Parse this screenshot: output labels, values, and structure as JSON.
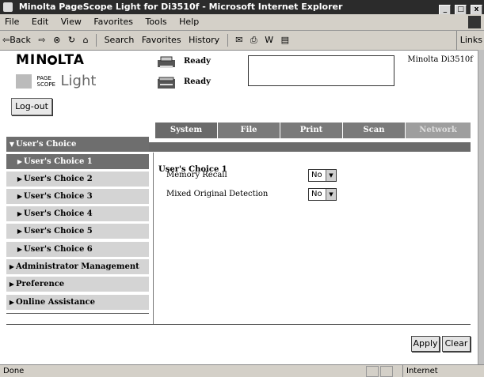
{
  "window": {
    "title": "Minolta PageScope Light for Di3510f - Microsoft Internet Explorer",
    "controls": [
      "_",
      "□",
      "x"
    ]
  },
  "menu": {
    "items": [
      "File",
      "Edit",
      "View",
      "Favorites",
      "Tools",
      "Help"
    ]
  },
  "toolbar": {
    "back": "⇦Back",
    "forward": "⇨",
    "stop": "⊗",
    "refresh": "↻",
    "home": "⌂",
    "search": "Search",
    "favorites": "Favorites",
    "history": "History",
    "mail": "✉",
    "print": "⎙",
    "edit": "W",
    "discuss": "▤",
    "links": "Links"
  },
  "header": {
    "brand": "MIN",
    "brand_rest": "LTA",
    "pagescope_small_1": "PAGE",
    "pagescope_small_2": "SCOPE",
    "pagescope_big": "Light",
    "printer_status": "Ready",
    "scanner_status": "Ready",
    "model": "Minolta Di3510f",
    "logout": "Log-out"
  },
  "tabs": [
    {
      "label": "System",
      "state": "active"
    },
    {
      "label": "File",
      "state": "normal"
    },
    {
      "label": "Print",
      "state": "normal"
    },
    {
      "label": "Scan",
      "state": "normal"
    },
    {
      "label": "Network",
      "state": "disabled"
    }
  ],
  "nav": {
    "group": "User's Choice",
    "subitems": [
      "User's Choice 1",
      "User's Choice 2",
      "User's Choice 3",
      "User's Choice 4",
      "User's Choice 5",
      "User's Choice 6"
    ],
    "others": [
      "Administrator Management",
      "Preference",
      "Online Assistance"
    ]
  },
  "content": {
    "title": "User's Choice 1",
    "settings": [
      {
        "label": "Memory Recall",
        "value": "No"
      },
      {
        "label": "Mixed Original Detection",
        "value": "No"
      }
    ]
  },
  "buttons": {
    "apply": "Apply",
    "clear": "Clear"
  },
  "statusbar": {
    "left": "Done",
    "zone": "Internet"
  }
}
